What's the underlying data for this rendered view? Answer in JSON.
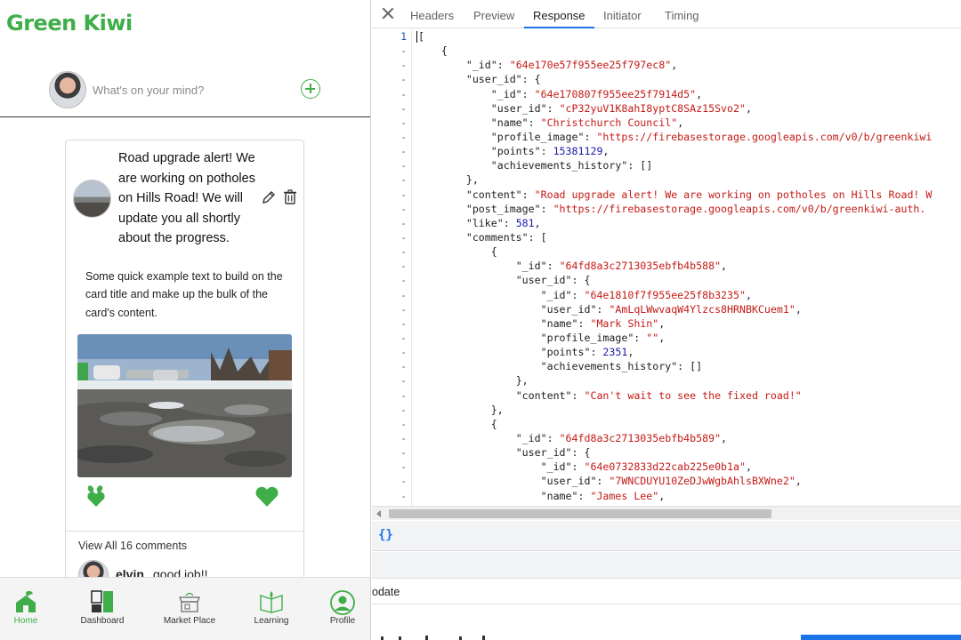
{
  "app": {
    "brand": "Green Kiwi",
    "composer_placeholder": "What's on your mind?",
    "post": {
      "title": "Road upgrade alert! We are working on potholes on Hills Road! We will update you all shortly about the progress.",
      "body": "Some quick example text to build on the card title and make up the bulk of the card's content.",
      "view_comments": "View All 16 comments",
      "comment_author": "elvin",
      "comment_text": "good job!!"
    },
    "nav": [
      {
        "label": "Home",
        "icon": "home-icon"
      },
      {
        "label": "Dashboard",
        "icon": "dashboard-icon"
      },
      {
        "label": "Market Place",
        "icon": "market-icon"
      },
      {
        "label": "Learning",
        "icon": "learning-icon"
      },
      {
        "label": "Profile",
        "icon": "profile-icon"
      }
    ],
    "colors": {
      "brand_green": "#3fae49"
    }
  },
  "devtools": {
    "tabs": [
      "Headers",
      "Preview",
      "Response",
      "Initiator",
      "Timing"
    ],
    "active_tab": "Response",
    "gutter": [
      "1",
      "-",
      "-",
      "-",
      "-",
      "-",
      "-",
      "-",
      "-",
      "-",
      "-",
      "-",
      "-",
      "-",
      "-",
      "-",
      "-",
      "-",
      "-",
      "-",
      "-",
      "-",
      "-",
      "-",
      "-",
      "-",
      "-",
      "-",
      "-",
      "-",
      "-",
      "-",
      "-"
    ],
    "lines": [
      {
        "indent": 0,
        "text": "["
      },
      {
        "indent": 1,
        "text": "{"
      },
      {
        "indent": 2,
        "key": "\"_id\"",
        "str": "\"64e170e57f955ee25f797ec8\"",
        "tail": ","
      },
      {
        "indent": 2,
        "key": "\"user_id\"",
        "tail": " {"
      },
      {
        "indent": 3,
        "key": "\"_id\"",
        "str": "\"64e170807f955ee25f7914d5\"",
        "tail": ","
      },
      {
        "indent": 3,
        "key": "\"user_id\"",
        "str": "\"cP32yuV1K8ahI8yptC8SAz15Svo2\"",
        "tail": ","
      },
      {
        "indent": 3,
        "key": "\"name\"",
        "str": "\"Christchurch Council\"",
        "tail": ","
      },
      {
        "indent": 3,
        "key": "\"profile_image\"",
        "str": "\"https://firebasestorage.googleapis.com/v0/b/greenkiwi",
        "tail": ""
      },
      {
        "indent": 3,
        "key": "\"points\"",
        "num": "15381129",
        "tail": ","
      },
      {
        "indent": 3,
        "key": "\"achievements_history\"",
        "tail": " []"
      },
      {
        "indent": 2,
        "text": "},"
      },
      {
        "indent": 2,
        "key": "\"content\"",
        "str": "\"Road upgrade alert! We are working on potholes on Hills Road! W",
        "tail": ""
      },
      {
        "indent": 2,
        "key": "\"post_image\"",
        "str": "\"https://firebasestorage.googleapis.com/v0/b/greenkiwi-auth.",
        "tail": ""
      },
      {
        "indent": 2,
        "key": "\"like\"",
        "num": "581",
        "tail": ","
      },
      {
        "indent": 2,
        "key": "\"comments\"",
        "tail": " ["
      },
      {
        "indent": 3,
        "text": "{"
      },
      {
        "indent": 4,
        "key": "\"_id\"",
        "str": "\"64fd8a3c2713035ebfb4b588\"",
        "tail": ","
      },
      {
        "indent": 4,
        "key": "\"user_id\"",
        "tail": " {"
      },
      {
        "indent": 5,
        "key": "\"_id\"",
        "str": "\"64e1810f7f955ee25f8b3235\"",
        "tail": ","
      },
      {
        "indent": 5,
        "key": "\"user_id\"",
        "str": "\"AmLqLWwvaqW4Ylzcs8HRNBKCuem1\"",
        "tail": ","
      },
      {
        "indent": 5,
        "key": "\"name\"",
        "str": "\"Mark Shin\"",
        "tail": ","
      },
      {
        "indent": 5,
        "key": "\"profile_image\"",
        "str": "\"\"",
        "tail": ","
      },
      {
        "indent": 5,
        "key": "\"points\"",
        "num": "2351",
        "tail": ","
      },
      {
        "indent": 5,
        "key": "\"achievements_history\"",
        "tail": " []"
      },
      {
        "indent": 4,
        "text": "},"
      },
      {
        "indent": 4,
        "key": "\"content\"",
        "str": "\"Can't wait to see the fixed road!\"",
        "tail": ""
      },
      {
        "indent": 3,
        "text": "},"
      },
      {
        "indent": 3,
        "text": "{"
      },
      {
        "indent": 4,
        "key": "\"_id\"",
        "str": "\"64fd8a3c2713035ebfb4b589\"",
        "tail": ","
      },
      {
        "indent": 4,
        "key": "\"user_id\"",
        "tail": " {"
      },
      {
        "indent": 5,
        "key": "\"_id\"",
        "str": "\"64e0732833d22cab225e0b1a\"",
        "tail": ","
      },
      {
        "indent": 5,
        "key": "\"user_id\"",
        "str": "\"7WNCDUYU10ZeDJwWgbAhlsBXWne2\"",
        "tail": ","
      },
      {
        "indent": 5,
        "key": "\"name\"",
        "str": "\"James Lee\"",
        "tail": ","
      }
    ],
    "pretty_print": "{}",
    "console_text": "odate",
    "colors": {
      "key": "#202124",
      "string": "#c41a16",
      "number": "#1a1aa6",
      "accent": "#1a73e8"
    }
  }
}
